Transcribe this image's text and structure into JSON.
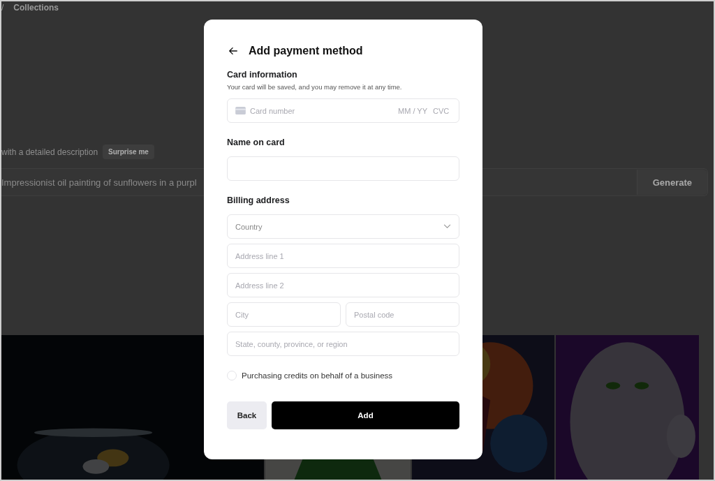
{
  "background": {
    "breadcrumb_separator": "/",
    "breadcrumb_item": "Collections",
    "prompt_hint": "with a detailed description",
    "surprise_button": "Surprise me",
    "prompt_placeholder": "Impressionist oil painting of sunflowers in a purpl",
    "generate_button": "Generate"
  },
  "dialog": {
    "title": "Add payment method",
    "card_section": {
      "label": "Card information",
      "hint": "Your card will be saved, and you may remove it at any time.",
      "number_placeholder": "Card number",
      "expiry_placeholder": "MM / YY",
      "cvc_placeholder": "CVC"
    },
    "name_section": {
      "label": "Name on card"
    },
    "billing_section": {
      "label": "Billing address",
      "country_placeholder": "Country",
      "address1_placeholder": "Address line 1",
      "address2_placeholder": "Address line 2",
      "city_placeholder": "City",
      "postal_placeholder": "Postal code",
      "region_placeholder": "State, county, province, or region"
    },
    "business_option": {
      "label": "Purchasing credits on behalf of a business",
      "checked": false
    },
    "buttons": [
      {
        "kind": "secondary",
        "label": "Back"
      },
      {
        "kind": "primary",
        "label": "Add"
      }
    ]
  }
}
